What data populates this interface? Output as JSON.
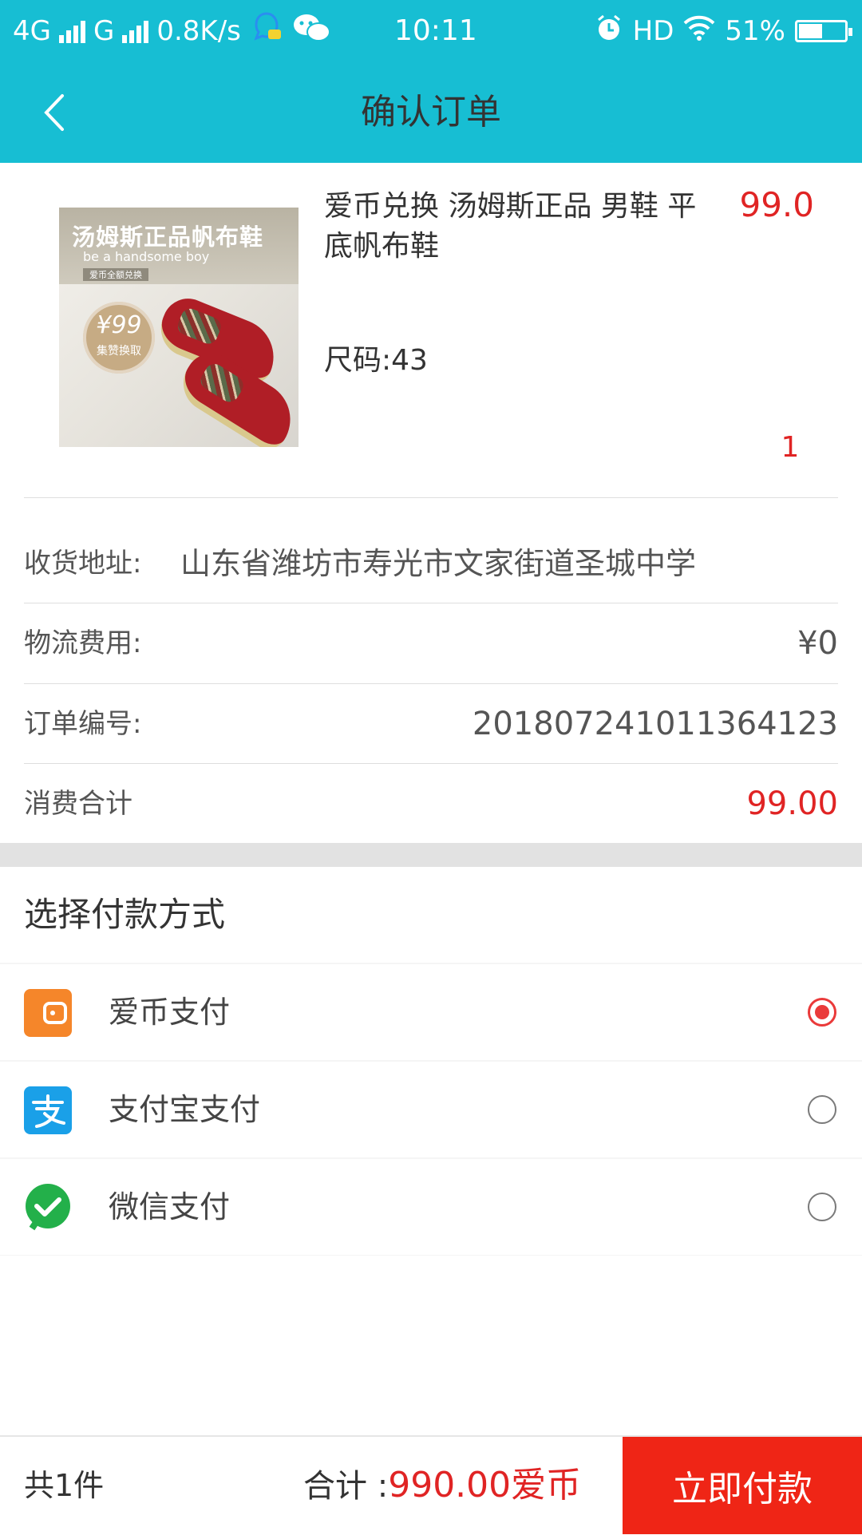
{
  "status_bar": {
    "network1": "4G",
    "network2": "G",
    "speed": "0.8K/s",
    "time": "10:11",
    "hd": "HD",
    "battery": "51%",
    "battery_level": 0.51
  },
  "header": {
    "title": "确认订单"
  },
  "product": {
    "title": "爱币兑换 汤姆斯正品 男鞋 平底帆布鞋",
    "price": "99.0",
    "size": "尺码:43",
    "quantity": "1",
    "image": {
      "banner_title": "汤姆斯正品帆布鞋",
      "banner_sub": "be a handsome boy",
      "banner_tag": "爱币全额兑换",
      "badge_price": "¥99",
      "badge_text": "集赞换取"
    }
  },
  "order_info": {
    "address_label": "收货地址:",
    "address_value": "山东省潍坊市寿光市文家街道圣城中学",
    "shipping_label": "物流费用:",
    "shipping_value": "¥0",
    "order_no_label": "订单编号:",
    "order_no_value": "20180724101136412 3",
    "total_label": "消费合计",
    "total_value": "99.00"
  },
  "payment": {
    "heading": "选择付款方式",
    "methods": [
      {
        "label": "爱币支付",
        "icon": "wallet-icon",
        "selected": true,
        "color": "#f5862a"
      },
      {
        "label": "支付宝支付",
        "icon": "alipay-icon",
        "selected": false,
        "color": "#1aa0e8"
      },
      {
        "label": "微信支付",
        "icon": "wechat-pay-icon",
        "selected": false,
        "color": "#23b04a"
      }
    ]
  },
  "footer": {
    "count": "共1件",
    "total_label": "合计 :",
    "total_amount": "990.00爱币",
    "pay_button": "立即付款"
  },
  "colors": {
    "brand": "#17bed3",
    "price_red": "#e02424",
    "pay_button": "#ef2516"
  }
}
